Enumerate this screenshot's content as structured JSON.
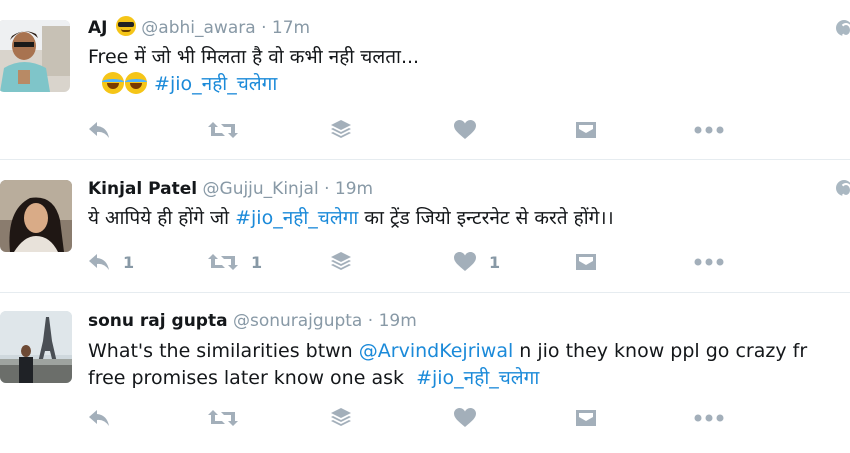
{
  "colors": {
    "link": "#1b8ad9",
    "muted": "#8899a6",
    "icon": "#a3afba",
    "divider": "#e6ecf0"
  },
  "tweets": [
    {
      "fullname": "AJ",
      "name_emoji": "smiling-face-with-sunglasses",
      "handle": "@abhi_awara",
      "separator": "·",
      "time": "17m",
      "text_line1": "Free में जो भी मिलता है वो कभी नही चलता...",
      "text_emoji": "face-with-tears-of-joy",
      "hashtag": "#jio_नही_चलेगा",
      "counts": {
        "reply": "",
        "retweet": "",
        "like": ""
      }
    },
    {
      "fullname": "Kinjal Patel",
      "handle": "@Gujju_Kinjal",
      "separator": "·",
      "time": "19m",
      "text_before": "ये आपिये ही होंगे जो ",
      "hashtag": "#jio_नही_चलेगा",
      "text_after": " का ट्रेंड जियो इन्टरनेट से करते होंगे।।",
      "counts": {
        "reply": "1",
        "retweet": "1",
        "like": "1"
      }
    },
    {
      "fullname": "sonu raj gupta",
      "handle": "@sonurajgupta",
      "separator": "·",
      "time": "19m",
      "text_before": "What's the similarities btwn ",
      "mention": "@ArvindKejriwal",
      "text_after": " n jio they know ppl go crazy fr free promises later know one ask  ",
      "hashtag": "#jio_नही_चलेगा",
      "counts": {
        "reply": "",
        "retweet": "",
        "like": ""
      }
    }
  ],
  "icons": [
    "reply-icon",
    "retweet-icon",
    "layers-icon",
    "heart-icon",
    "message-icon",
    "more-icon",
    "globe-icon"
  ]
}
